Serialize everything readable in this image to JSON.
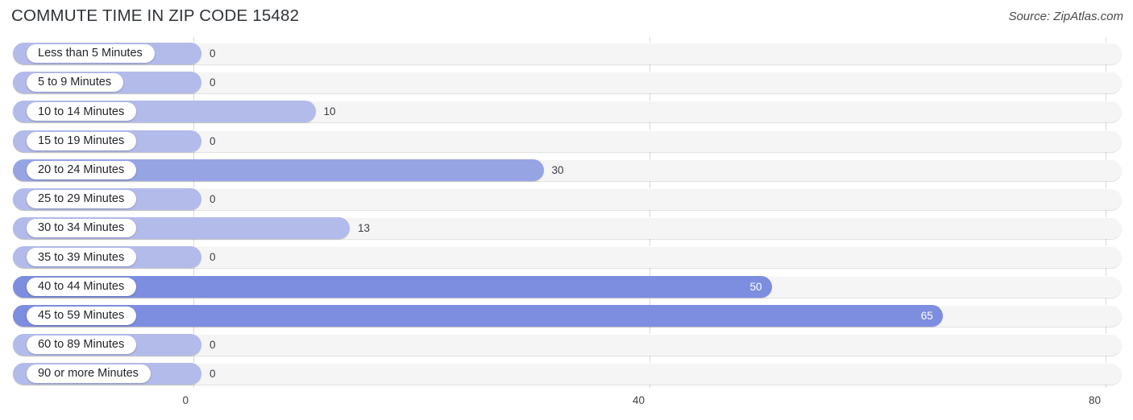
{
  "header": {
    "title": "COMMUTE TIME IN ZIP CODE 15482",
    "source": "Source: ZipAtlas.com"
  },
  "chart_data": {
    "type": "bar",
    "orientation": "horizontal",
    "title": "COMMUTE TIME IN ZIP CODE 15482",
    "subtitle": "Source: ZipAtlas.com",
    "xlabel": "",
    "ylabel": "",
    "xlim": [
      0,
      80
    ],
    "xticks": [
      0,
      40,
      80
    ],
    "xtick_labels": [
      "0",
      "40",
      "80"
    ],
    "grid": true,
    "legend": false,
    "categories": [
      "Less than 5 Minutes",
      "5 to 9 Minutes",
      "10 to 14 Minutes",
      "15 to 19 Minutes",
      "20 to 24 Minutes",
      "25 to 29 Minutes",
      "30 to 34 Minutes",
      "35 to 39 Minutes",
      "40 to 44 Minutes",
      "45 to 59 Minutes",
      "60 to 89 Minutes",
      "90 or more Minutes"
    ],
    "values": [
      0,
      0,
      10,
      0,
      30,
      0,
      13,
      0,
      50,
      65,
      0,
      0
    ],
    "value_labels": [
      "0",
      "0",
      "10",
      "0",
      "30",
      "0",
      "13",
      "0",
      "50",
      "65",
      "0",
      "0"
    ],
    "colors": {
      "bar_light": "#b3bbeb",
      "bar_mid": "#97a4e4",
      "bar_dark": "#7d8de0",
      "track": "#f5f5f5",
      "gridline": "#d9d9d9",
      "text": "#3b3f45",
      "value_inside": "#ffffff"
    }
  }
}
